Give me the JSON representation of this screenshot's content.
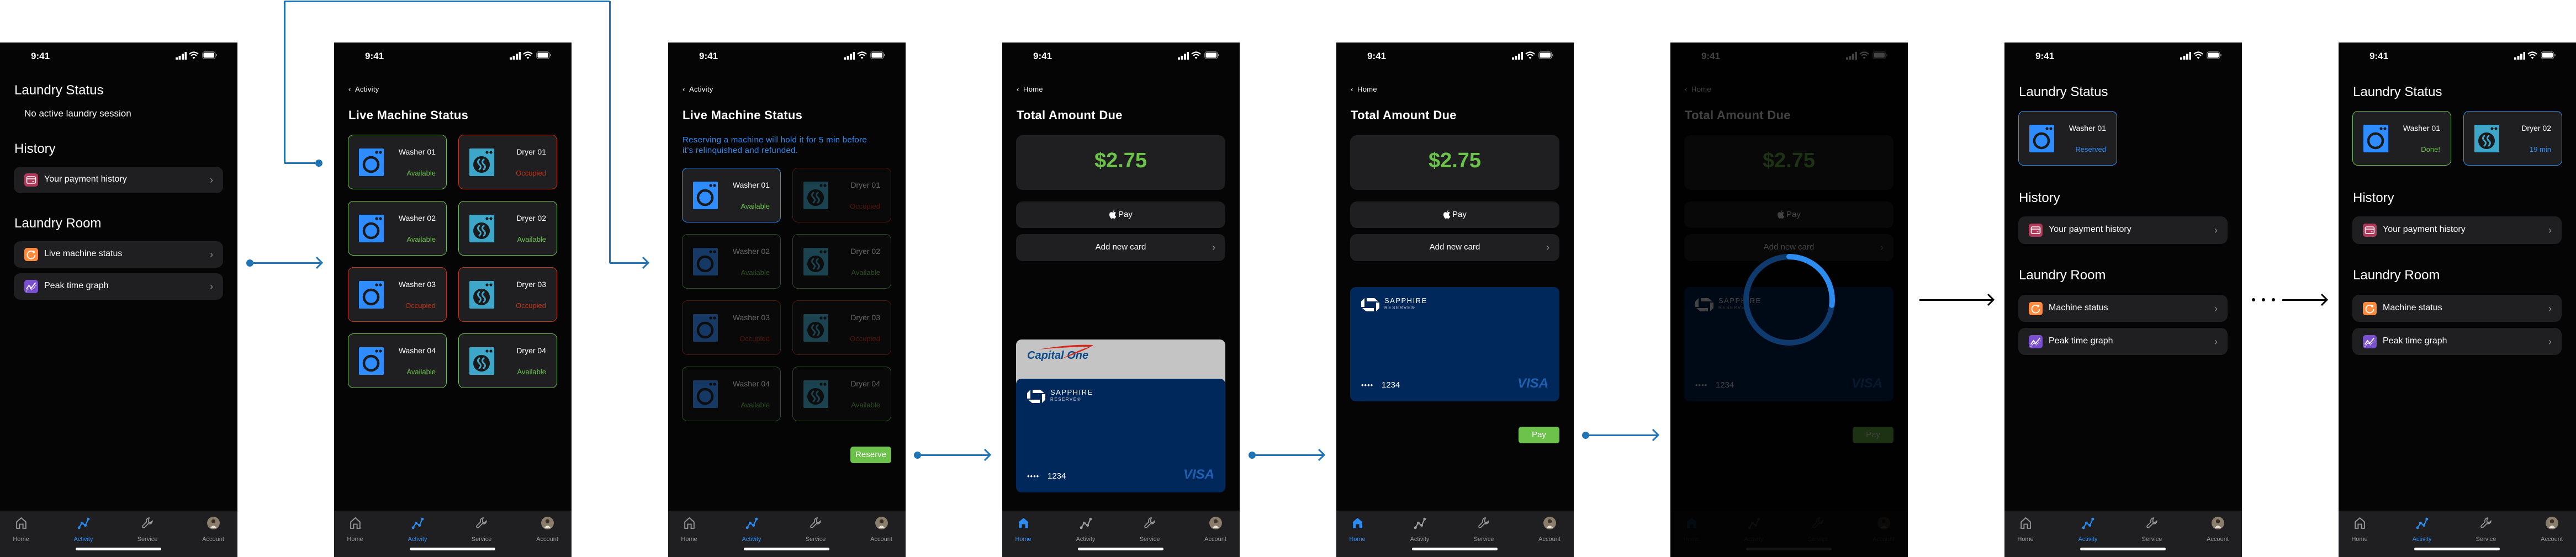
{
  "status_bar": {
    "time": "9:41"
  },
  "colors": {
    "background": "#050505",
    "surface": "#1f1f21",
    "available": "#6cc24a",
    "occupied": "#c8320c",
    "accent_blue": "#2d8cf0",
    "washer_icon": "#2f8cff",
    "dryer_icon": "#3ea6c8",
    "payment_icon": "#b03a5b",
    "machine_status_icon": "#ff8a3d",
    "peak_graph_icon": "#7a4fd0",
    "flow_arrow": "#1f73b7",
    "card_navy": "#00285a"
  },
  "tabs": [
    {
      "label": "Home",
      "icon": "home-icon"
    },
    {
      "label": "Activity",
      "icon": "activity-icon"
    },
    {
      "label": "Service",
      "icon": "wrench-icon"
    },
    {
      "label": "Account",
      "icon": "avatar"
    }
  ],
  "screens": [
    {
      "kind": "home",
      "active_tab": 1,
      "laundry_status_title": "Laundry Status",
      "session_text": "No active laundry session",
      "history_title": "History",
      "history_items": [
        {
          "label": "Your payment history",
          "icon": "credit-card-icon"
        }
      ],
      "room_title": "Laundry Room",
      "room_items": [
        {
          "label": "Live machine status",
          "icon": "machine-status-icon"
        },
        {
          "label": "Peak time graph",
          "icon": "peak-graph-icon"
        }
      ]
    },
    {
      "kind": "machines",
      "active_tab": 1,
      "back_label": "Activity",
      "title": "Live Machine Status",
      "machines": [
        {
          "name": "Washer 01",
          "type": "washer",
          "status": "Available",
          "state": "available"
        },
        {
          "name": "Dryer 01",
          "type": "dryer",
          "status": "Occupied",
          "state": "occupied"
        },
        {
          "name": "Washer 02",
          "type": "washer",
          "status": "Available",
          "state": "available"
        },
        {
          "name": "Dryer 02",
          "type": "dryer",
          "status": "Available",
          "state": "available"
        },
        {
          "name": "Washer 03",
          "type": "washer",
          "status": "Occupied",
          "state": "occupied"
        },
        {
          "name": "Dryer 03",
          "type": "dryer",
          "status": "Occupied",
          "state": "occupied"
        },
        {
          "name": "Washer 04",
          "type": "washer",
          "status": "Available",
          "state": "available"
        },
        {
          "name": "Dryer 04",
          "type": "dryer",
          "status": "Available",
          "state": "available"
        }
      ]
    },
    {
      "kind": "machines_reserve",
      "active_tab": 1,
      "back_label": "Activity",
      "title": "Live Machine Status",
      "note_line1": "Reserving a machine will hold it for 5 min before",
      "note_line2": "it’s relinquished and refunded.",
      "selected_index": 0,
      "reserve_label": "Reserve",
      "machines": [
        {
          "name": "Washer 01",
          "type": "washer",
          "status": "Available",
          "state": "available"
        },
        {
          "name": "Dryer 01",
          "type": "dryer",
          "status": "Occupied",
          "state": "occupied"
        },
        {
          "name": "Washer 02",
          "type": "washer",
          "status": "Available",
          "state": "available"
        },
        {
          "name": "Dryer 02",
          "type": "dryer",
          "status": "Available",
          "state": "available"
        },
        {
          "name": "Washer 03",
          "type": "washer",
          "status": "Occupied",
          "state": "occupied"
        },
        {
          "name": "Dryer 03",
          "type": "dryer",
          "status": "Occupied",
          "state": "occupied"
        },
        {
          "name": "Washer 04",
          "type": "washer",
          "status": "Available",
          "state": "available"
        },
        {
          "name": "Dryer 04",
          "type": "dryer",
          "status": "Available",
          "state": "available"
        }
      ]
    },
    {
      "kind": "payment_wallet",
      "active_tab": 0,
      "back_label": "Home",
      "title": "Total Amount Due",
      "amount": "$2.75",
      "apple_pay_label": "Pay",
      "add_card_label": "Add new card",
      "cards": [
        {
          "brand": "Capital One"
        },
        {
          "brand": "SAPPHIRE",
          "sub": "RESERVE®",
          "masked": "••••",
          "last4": "1234",
          "network": "VISA"
        }
      ]
    },
    {
      "kind": "payment_selected",
      "active_tab": 0,
      "back_label": "Home",
      "title": "Total Amount Due",
      "amount": "$2.75",
      "apple_pay_label": "Pay",
      "add_card_label": "Add new card",
      "cards": [
        {
          "brand": "SAPPHIRE",
          "sub": "RESERVE®",
          "masked": "••••",
          "last4": "1234",
          "network": "VISA"
        }
      ],
      "pay_label": "Pay"
    },
    {
      "kind": "payment_processing",
      "active_tab": 0,
      "back_label": "Home",
      "title": "Total Amount Due",
      "amount": "$2.75",
      "apple_pay_label": "Pay",
      "add_card_label": "Add new card",
      "cards": [
        {
          "brand": "SAPPHIRE",
          "sub": "RESERVE®",
          "masked": "••••",
          "last4": "1234",
          "network": "VISA"
        }
      ],
      "pay_label": "Pay",
      "progress": 0.27
    },
    {
      "kind": "home_active",
      "active_tab": 1,
      "laundry_status_title": "Laundry Status",
      "sessions": [
        {
          "name": "Washer 01",
          "type": "washer",
          "status": "Reserved",
          "state": "reserved"
        }
      ],
      "history_title": "History",
      "history_items": [
        {
          "label": "Your payment history",
          "icon": "credit-card-icon"
        }
      ],
      "room_title": "Laundry Room",
      "room_items": [
        {
          "label": "Machine status",
          "icon": "machine-status-icon"
        },
        {
          "label": "Peak time graph",
          "icon": "peak-graph-icon"
        }
      ]
    },
    {
      "kind": "home_active",
      "active_tab": 1,
      "laundry_status_title": "Laundry Status",
      "sessions": [
        {
          "name": "Washer 01",
          "type": "washer",
          "status": "Done!",
          "state": "done"
        },
        {
          "name": "Dryer 02",
          "type": "dryer",
          "status": "19 min",
          "state": "running"
        }
      ],
      "history_title": "History",
      "history_items": [
        {
          "label": "Your payment history",
          "icon": "credit-card-icon"
        }
      ],
      "room_title": "Laundry Room",
      "room_items": [
        {
          "label": "Machine status",
          "icon": "machine-status-icon"
        },
        {
          "label": "Peak time graph",
          "icon": "peak-graph-icon"
        }
      ]
    }
  ]
}
